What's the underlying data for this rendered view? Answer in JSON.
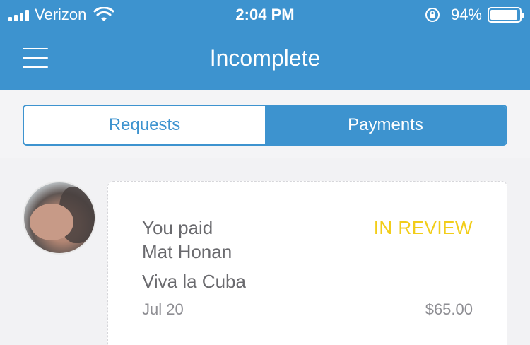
{
  "status_bar": {
    "carrier": "Verizon",
    "time": "2:04 PM",
    "battery": "94%",
    "battery_level": 0.94,
    "icons": [
      "signal-icon",
      "wifi-icon",
      "rotation-lock-icon",
      "battery-icon"
    ]
  },
  "nav": {
    "title": "Incomplete",
    "menu_icon": "hamburger-menu-icon"
  },
  "segments": {
    "requests_label": "Requests",
    "payments_label": "Payments",
    "selected": "Payments"
  },
  "transaction": {
    "line1": "You paid",
    "payee": "Mat Honan",
    "status": "IN REVIEW",
    "memo": "Viva la Cuba",
    "date": "Jul 20",
    "amount": "$65.00"
  },
  "colors": {
    "primary": "#3d93cf",
    "status_in_review": "#f2cd1a",
    "text_primary": "#6a6a6e",
    "text_secondary": "#8e8e93",
    "background": "#f2f2f4"
  }
}
